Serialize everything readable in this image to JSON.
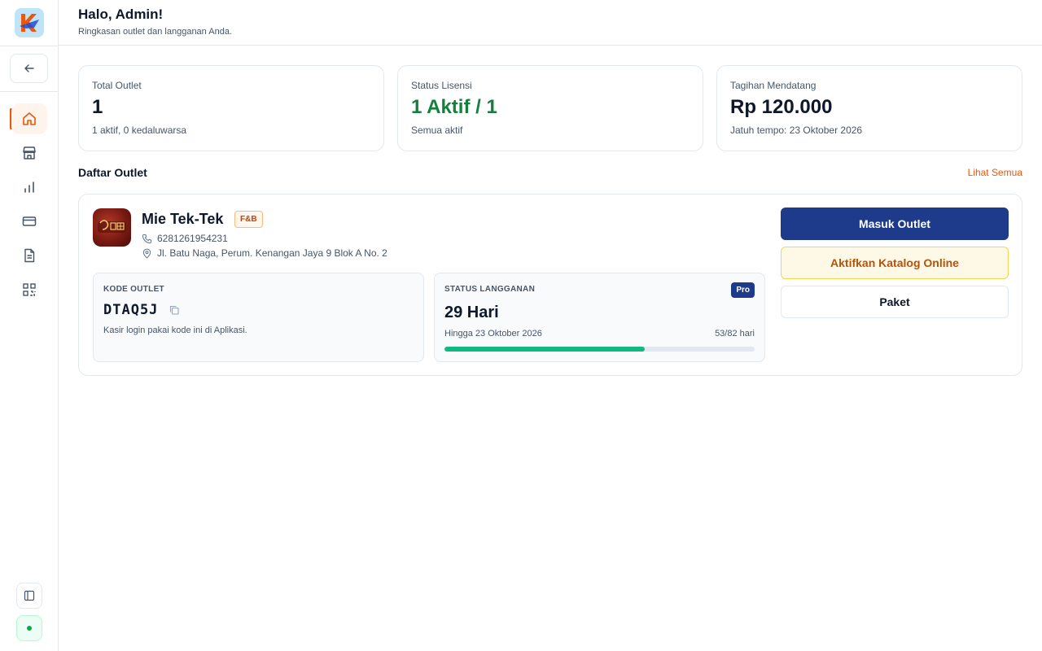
{
  "header": {
    "greeting": "Halo, Admin!",
    "subtitle": "Ringkasan outlet dan langganan Anda."
  },
  "sidebar": {
    "items": [
      {
        "icon": "home-icon",
        "active": true
      },
      {
        "icon": "store-icon",
        "active": false
      },
      {
        "icon": "bar-chart-icon",
        "active": false
      },
      {
        "icon": "credit-card-icon",
        "active": false
      },
      {
        "icon": "document-icon",
        "active": false
      },
      {
        "icon": "qr-code-icon",
        "active": false
      }
    ]
  },
  "stats": [
    {
      "label": "Total Outlet",
      "value": "1",
      "sub": "1 aktif, 0 kedaluwarsa"
    },
    {
      "label": "Status Lisensi",
      "value": "1 Aktif / 1",
      "sub": "Semua aktif",
      "value_color": "#15803d"
    },
    {
      "label": "Tagihan Mendatang",
      "value": "Rp 120.000",
      "sub": "Jatuh tempo: 23 Oktober 2026"
    }
  ],
  "outlets_section": {
    "title": "Daftar Outlet",
    "see_all": "Lihat Semua"
  },
  "outlet": {
    "name": "Mie Tek-Tek",
    "category": "F&B",
    "phone": "6281261954231",
    "address": "Jl. Batu Naga, Perum. Kenangan Jaya 9 Blok A No. 2",
    "code_label": "KODE OUTLET",
    "code": "DTAQ5J",
    "code_note": "Kasir login pakai kode ini di Aplikasi.",
    "subscription_label": "STATUS LANGGANAN",
    "plan": "Pro",
    "days_left": "29 Hari",
    "until": "Hingga 23 Oktober 2026",
    "ratio": "53/82 hari",
    "progress_fraction": 0.646
  },
  "actions": {
    "enter": "Masuk Outlet",
    "activate_catalog": "Aktifkan Katalog Online",
    "package": "Paket"
  },
  "colors": {
    "accent": "#ea580c",
    "primary": "#1e3a8a",
    "success": "#15803d",
    "progress": "#10b981"
  }
}
